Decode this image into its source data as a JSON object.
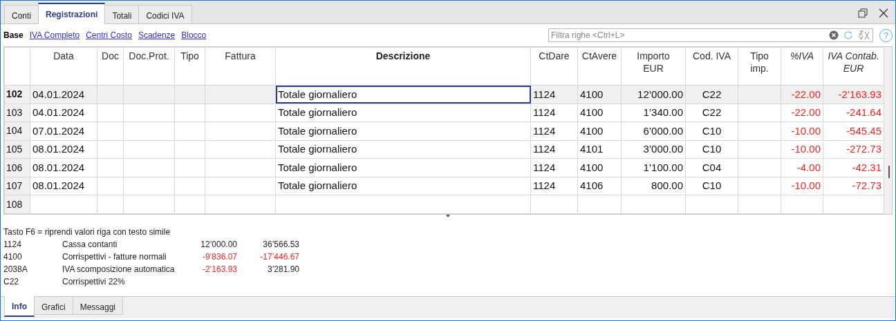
{
  "tabs": [
    {
      "label": "Conti",
      "selected": false
    },
    {
      "label": "Registrazioni",
      "selected": true
    },
    {
      "label": "Totali",
      "selected": false
    },
    {
      "label": "Codici IVA",
      "selected": false
    }
  ],
  "views": [
    {
      "label": "Base",
      "selected": true
    },
    {
      "label": "IVA Completo",
      "selected": false
    },
    {
      "label": "Centri Costo",
      "selected": false
    },
    {
      "label": "Scadenze",
      "selected": false
    },
    {
      "label": "Blocco",
      "selected": false
    }
  ],
  "filter": {
    "placeholder": "Filtra righe <Ctrl+L>",
    "help": "?"
  },
  "table": {
    "columns": [
      {
        "label": "Data",
        "current": false
      },
      {
        "label": "Doc",
        "current": false
      },
      {
        "label": "Doc.Prot.",
        "current": false
      },
      {
        "label": "Tipo",
        "current": false
      },
      {
        "label": "Fattura",
        "current": false
      },
      {
        "label": "Descrizione",
        "current": true
      },
      {
        "label": "CtDare",
        "current": false
      },
      {
        "label": "CtAvere",
        "current": false
      },
      {
        "label": "Importo\nEUR",
        "current": false
      },
      {
        "label": "Cod. IVA",
        "current": false
      },
      {
        "label": "Tipo\nimp.",
        "current": false
      },
      {
        "label": "%IVA",
        "current": false
      },
      {
        "label": "IVA Contab.\nEUR",
        "current": false
      }
    ],
    "rows": [
      {
        "number": "102",
        "selected": true,
        "date": "04.01.2024",
        "description": "Totale giornaliero",
        "ct_dare": "1124",
        "ct_avere": "4100",
        "importo": "12’000.00",
        "cod_iva": "C22",
        "perc_iva": "-22.00",
        "iva_contab": "-2’163.93"
      },
      {
        "number": "103",
        "selected": false,
        "date": "04.01.2024",
        "description": "Totale giornaliero",
        "ct_dare": "1124",
        "ct_avere": "4100",
        "importo": "1’340.00",
        "cod_iva": "C22",
        "perc_iva": "-22.00",
        "iva_contab": "-241.64"
      },
      {
        "number": "104",
        "selected": false,
        "date": "07.01.2024",
        "description": "Totale giornaliero",
        "ct_dare": "1124",
        "ct_avere": "4100",
        "importo": "6’000.00",
        "cod_iva": "C10",
        "perc_iva": "-10.00",
        "iva_contab": "-545.45"
      },
      {
        "number": "105",
        "selected": false,
        "date": "08.01.2024",
        "description": "Totale giornaliero",
        "ct_dare": "1124",
        "ct_avere": "4101",
        "importo": "3’000.00",
        "cod_iva": "C10",
        "perc_iva": "-10.00",
        "iva_contab": "-272.73"
      },
      {
        "number": "106",
        "selected": false,
        "date": "08.01.2024",
        "description": "Totale giornaliero",
        "ct_dare": "1124",
        "ct_avere": "4100",
        "importo": "1’100.00",
        "cod_iva": "C04",
        "perc_iva": "-4.00",
        "iva_contab": "-42.31"
      },
      {
        "number": "107",
        "selected": false,
        "date": "08.01.2024",
        "description": "Totale giornaliero",
        "ct_dare": "1124",
        "ct_avere": "4106",
        "importo": "800.00",
        "cod_iva": "C10",
        "perc_iva": "-10.00",
        "iva_contab": "-72.73"
      },
      {
        "number": "108",
        "selected": false
      }
    ]
  },
  "info": {
    "hint": "Tasto F6 = riprendi valori riga con testo simile",
    "lines": [
      {
        "account": "1124",
        "description": "Cassa contanti",
        "amount": {
          "text": "12’000.00",
          "negative": false
        },
        "balance": {
          "text": "36’566.53",
          "negative": false
        }
      },
      {
        "account": "4100",
        "description": "Corrispettivi - fatture normali",
        "amount": {
          "text": "-9’836.07",
          "negative": true
        },
        "balance": {
          "text": "-17’446.67",
          "negative": true
        }
      },
      {
        "account": "2038A",
        "description": "IVA scomposizione automatica",
        "amount": {
          "text": "-2’163.93",
          "negative": true
        },
        "balance": {
          "text": "3’281.90",
          "negative": false
        }
      },
      {
        "account": "C22",
        "description": "Corrispettivi 22%"
      }
    ]
  },
  "bottom_tabs": [
    {
      "label": "Info",
      "selected": true
    },
    {
      "label": "Grafici",
      "selected": false
    },
    {
      "label": "Messaggi",
      "selected": false
    }
  ]
}
